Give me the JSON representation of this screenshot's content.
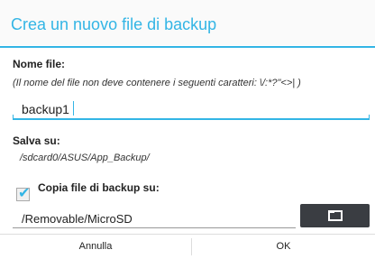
{
  "dialog": {
    "title": "Crea un nuovo file di backup",
    "file_name_label": "Nome file:",
    "file_name_hint": "(Il nome del file non deve contenere i seguenti caratteri: \\/:*?\"<>| )",
    "file_name_value": "backup1",
    "save_to_label": "Salva su:",
    "save_to_path": "/sdcard0/ASUS/App_Backup/",
    "copy_checkbox_label": "Copia file di backup su:",
    "copy_checked": true,
    "copy_path_value": "/Removable/MicroSD",
    "cancel_label": "Annulla",
    "ok_label": "OK"
  },
  "colors": {
    "accent": "#33b5e5",
    "button_dark": "#3a3d42"
  },
  "icons": {
    "folder_button": "folder-icon",
    "checkbox": "check-icon"
  }
}
